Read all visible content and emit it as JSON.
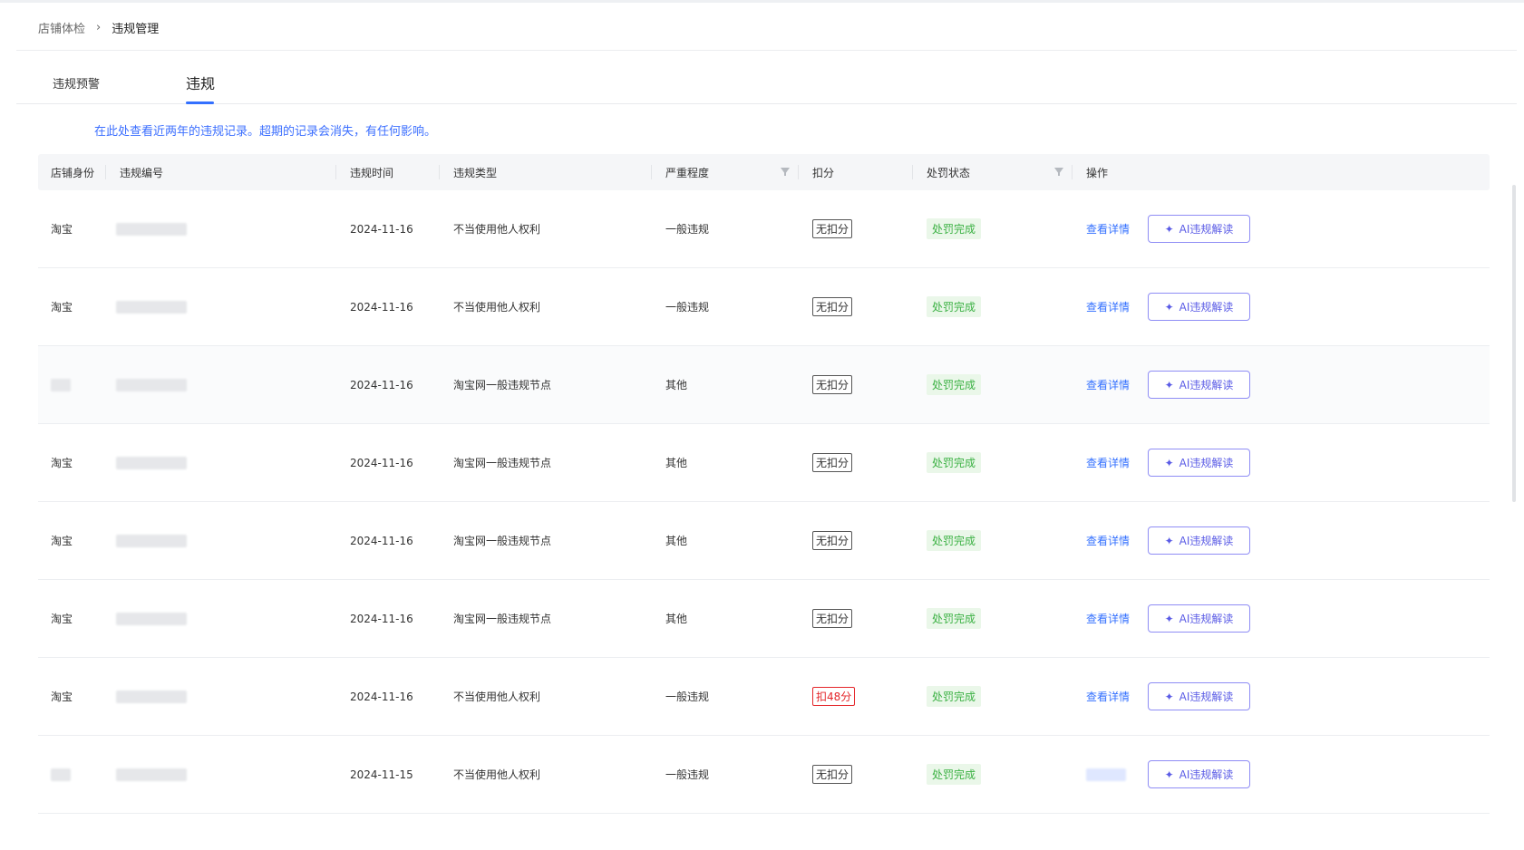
{
  "breadcrumb": {
    "parent": "店铺体检",
    "separator": "›",
    "current": "违规管理"
  },
  "tabs": [
    {
      "label": "违规预警",
      "active": false
    },
    {
      "label": "违规",
      "active": true
    }
  ],
  "notice": "在此处查看近两年的违规记录。超期的记录会消失，有任何影响。",
  "table": {
    "columns": [
      "店铺身份",
      "违规编号",
      "违规时间",
      "违规类型",
      "严重程度",
      "扣分",
      "处罚状态",
      "操作"
    ],
    "filterable": [
      "严重程度",
      "处罚状态"
    ],
    "rows": [
      {
        "shop": "淘宝",
        "time": "2024-11-16",
        "type": "不当使用他人权利",
        "severity": "一般违规",
        "deduction": "无扣分",
        "deduct_style": "none",
        "status": "处罚完成",
        "action_link": "查看详情",
        "ai_label": "AI违规解读"
      },
      {
        "shop": "淘宝",
        "time": "2024-11-16",
        "type": "不当使用他人权利",
        "severity": "一般违规",
        "deduction": "无扣分",
        "deduct_style": "none",
        "status": "处罚完成",
        "action_link": "查看详情",
        "ai_label": "AI违规解读"
      },
      {
        "shop": "",
        "time": "2024-11-16",
        "type": "淘宝网一般违规节点",
        "severity": "其他",
        "deduction": "无扣分",
        "deduct_style": "none",
        "status": "处罚完成",
        "action_link": "查看详情",
        "ai_label": "AI违规解读"
      },
      {
        "shop": "淘宝",
        "time": "2024-11-16",
        "type": "淘宝网一般违规节点",
        "severity": "其他",
        "deduction": "无扣分",
        "deduct_style": "none",
        "status": "处罚完成",
        "action_link": "查看详情",
        "ai_label": "AI违规解读"
      },
      {
        "shop": "淘宝",
        "time": "2024-11-16",
        "type": "淘宝网一般违规节点",
        "severity": "其他",
        "deduction": "无扣分",
        "deduct_style": "none",
        "status": "处罚完成",
        "action_link": "查看详情",
        "ai_label": "AI违规解读"
      },
      {
        "shop": "淘宝",
        "time": "2024-11-16",
        "type": "淘宝网一般违规节点",
        "severity": "其他",
        "deduction": "无扣分",
        "deduct_style": "none",
        "status": "处罚完成",
        "action_link": "查看详情",
        "ai_label": "AI违规解读"
      },
      {
        "shop": "淘宝",
        "time": "2024-11-16",
        "type": "不当使用他人权利",
        "severity": "一般违规",
        "deduction": "扣48分",
        "deduct_style": "red",
        "status": "处罚完成",
        "action_link": "查看详情",
        "ai_label": "AI违规解读"
      },
      {
        "shop": "",
        "time": "2024-11-15",
        "type": "不当使用他人权利",
        "severity": "一般违规",
        "deduction": "无扣分",
        "deduct_style": "none",
        "status": "处罚完成",
        "action_link": "",
        "ai_label": "AI违规解读"
      }
    ]
  },
  "colors": {
    "primary": "#3370ff",
    "ai_purple": "#5b5ce6",
    "success": "#3bb143",
    "danger": "#e4262a"
  },
  "icons": {
    "ai_star": "sparkle-icon",
    "filter": "filter-icon",
    "separator": "chevron-right-icon"
  }
}
